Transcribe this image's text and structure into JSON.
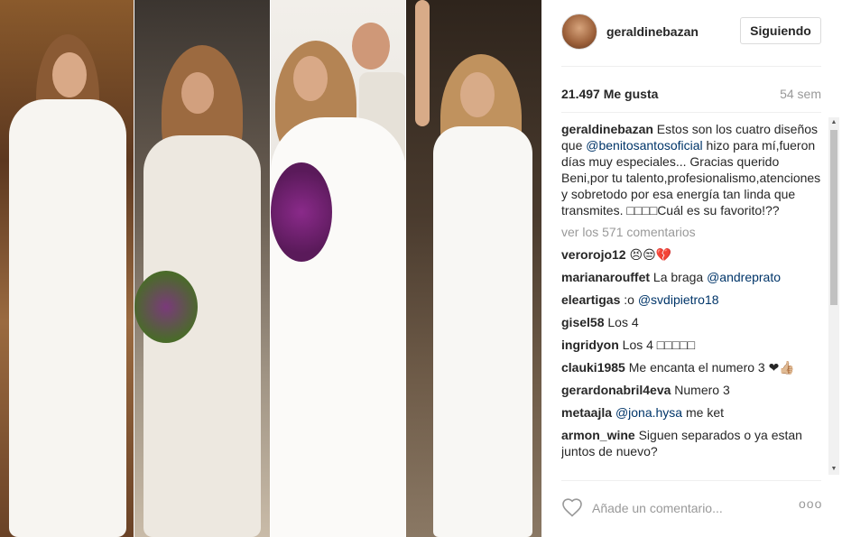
{
  "post": {
    "username": "geraldinebazan",
    "follow_label": "Siguiendo",
    "likes": "21.497 Me gusta",
    "time": "54 sem",
    "caption": {
      "user": "geraldinebazan",
      "text_1": " Estos son los cuatro diseños que ",
      "mention": "@benitosantosoficial",
      "text_2": " hizo para mí,fueron días muy especiales... Gracias querido Beni,por tu talento,profesionalismo,atenciones y sobretodo por esa energía tan linda que transmites. ",
      "emojis": "□□□□",
      "text_3": "Cuál es su favorito!??"
    },
    "view_all": "ver los 571 comentarios",
    "comments": [
      {
        "user": "verorojo12",
        "text": " 😣😒💔",
        "mention": ""
      },
      {
        "user": "marianarouffet",
        "text": " La braga ",
        "mention": "@andreprato"
      },
      {
        "user": "eleartigas",
        "text": " :o ",
        "mention": "@svdipietro18"
      },
      {
        "user": "gisel58",
        "text": " Los 4",
        "mention": ""
      },
      {
        "user": "ingridyon",
        "text": " Los 4 □□□□□",
        "mention": ""
      },
      {
        "user": "clauki1985",
        "text": " Me encanta el numero 3 ❤👍🏼",
        "mention": ""
      },
      {
        "user": "gerardonabril4eva",
        "text": " Numero 3",
        "mention": ""
      },
      {
        "user": "metaajla",
        "text": " ",
        "mention": "@jona.hysa",
        "after": " me ket"
      },
      {
        "user": "armon_wine",
        "text": " Siguen separados o ya estan juntos de nuevo?",
        "mention": ""
      }
    ],
    "comment_placeholder": "Añade un comentario...",
    "more_options": "ooo"
  },
  "colors": {
    "mention": "#003569",
    "muted": "#999999",
    "text": "#262626",
    "border": "#dbdbdb"
  },
  "icons": {
    "like": "heart-outline-icon",
    "options": "more-options-icon",
    "scroll_up": "scroll-up-arrow-icon",
    "scroll_down": "scroll-down-arrow-icon"
  }
}
